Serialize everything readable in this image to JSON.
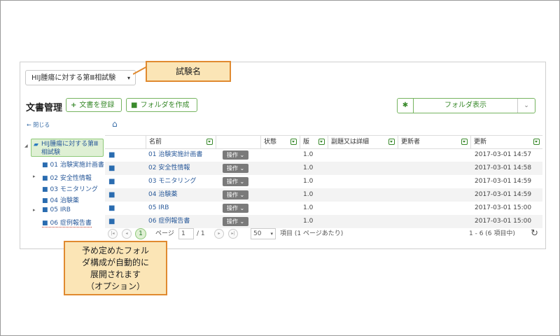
{
  "trial_select": {
    "value": "HIJ腫瘍に対する第Ⅲ相試験",
    "caret": "▾"
  },
  "callouts": {
    "trial_name": "試験名",
    "auto_expand_lines": [
      "予め定めたフォル",
      "ダ構成が自動的に",
      "展開されます",
      "（オプション）"
    ]
  },
  "heading": "文書管理",
  "buttons": {
    "register": {
      "icon": "+",
      "label": "文書を登録"
    },
    "create_folder": {
      "icon": "■",
      "label": "フォルダを作成"
    },
    "folder_view": {
      "icon": "✱",
      "label": "フォルダ表示",
      "caret": "⌄"
    }
  },
  "close_link": "← 閉じる",
  "home_icon": "⌂",
  "tree": {
    "root": "HIJ腫瘍に対する第Ⅲ相試験",
    "items": [
      {
        "label": "01 治験実施計画書",
        "toggle": ""
      },
      {
        "label": "02 安全性情報",
        "toggle": "▸"
      },
      {
        "label": "03 モニタリング",
        "toggle": ""
      },
      {
        "label": "04 治験薬",
        "toggle": ""
      },
      {
        "label": "05 IRB",
        "toggle": "▸"
      },
      {
        "label": "06 症例報告書",
        "toggle": ""
      }
    ]
  },
  "grid": {
    "headers": [
      "名前",
      "状態",
      "版",
      "副題又は詳細",
      "更新者",
      "更新"
    ],
    "rows": [
      {
        "name": "01 治験実施計画書",
        "op": "操作 ⌄",
        "version": "1.0",
        "updated": "2017-03-01 14:57"
      },
      {
        "name": "02 安全性情報",
        "op": "操作 ⌄",
        "version": "1.0",
        "updated": "2017-03-01 14:58"
      },
      {
        "name": "03 モニタリング",
        "op": "操作 ⌄",
        "version": "1.0",
        "updated": "2017-03-01 14:59"
      },
      {
        "name": "04 治験薬",
        "op": "操作 ⌄",
        "version": "1.0",
        "updated": "2017-03-01 14:59"
      },
      {
        "name": "05 IRB",
        "op": "操作 ⌄",
        "version": "1.0",
        "updated": "2017-03-01 15:00"
      },
      {
        "name": "06 症例報告書",
        "op": "操作 ⌄",
        "version": "1.0",
        "updated": "2017-03-01 15:00"
      }
    ]
  },
  "pager": {
    "first": "|◂",
    "prev": "◂",
    "current": "1",
    "page_label": "ページ",
    "page_value": "1",
    "page_total": "/ 1",
    "next": "▸",
    "last": "▸|",
    "page_size": "50",
    "page_size_caret": "▾",
    "items_per_page": "項目 (1 ページあたり)",
    "summary": "1 - 6 (6 項目中)",
    "refresh": "↻"
  }
}
